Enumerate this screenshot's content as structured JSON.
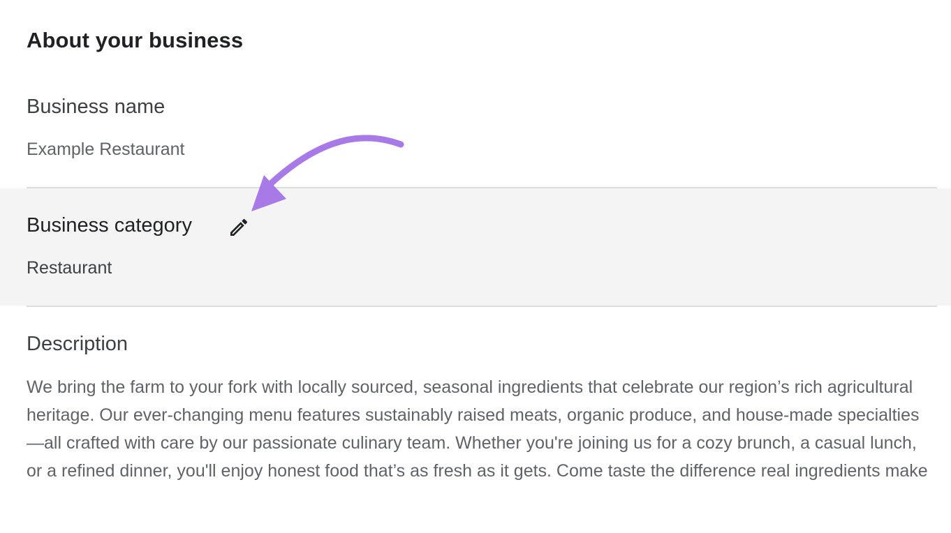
{
  "header": {
    "title": "About your business"
  },
  "business_name": {
    "label": "Business name",
    "value": "Example Restaurant"
  },
  "business_category": {
    "label": "Business category",
    "value": "Restaurant",
    "edit_icon": "pencil-icon"
  },
  "description": {
    "label": "Description",
    "text": "We bring the farm to your fork with locally sourced, seasonal ingredients that celebrate our region’s rich agricultural heritage. Our ever-changing menu features sustainably raised meats, organic produce, and house-made specialties—all crafted with care by our passionate culinary team. Whether you're joining us for a cozy brunch, a casual lunch, or a refined dinner, you'll enjoy honest food that’s as fresh as it gets. Come taste the difference real ingredients make"
  },
  "annotation": {
    "arrow_color": "#a77ae8"
  },
  "colors": {
    "highlight_row": "#f4f4f4",
    "divider": "#dadce0",
    "text_primary": "#202124",
    "text_secondary": "#5f6368"
  }
}
